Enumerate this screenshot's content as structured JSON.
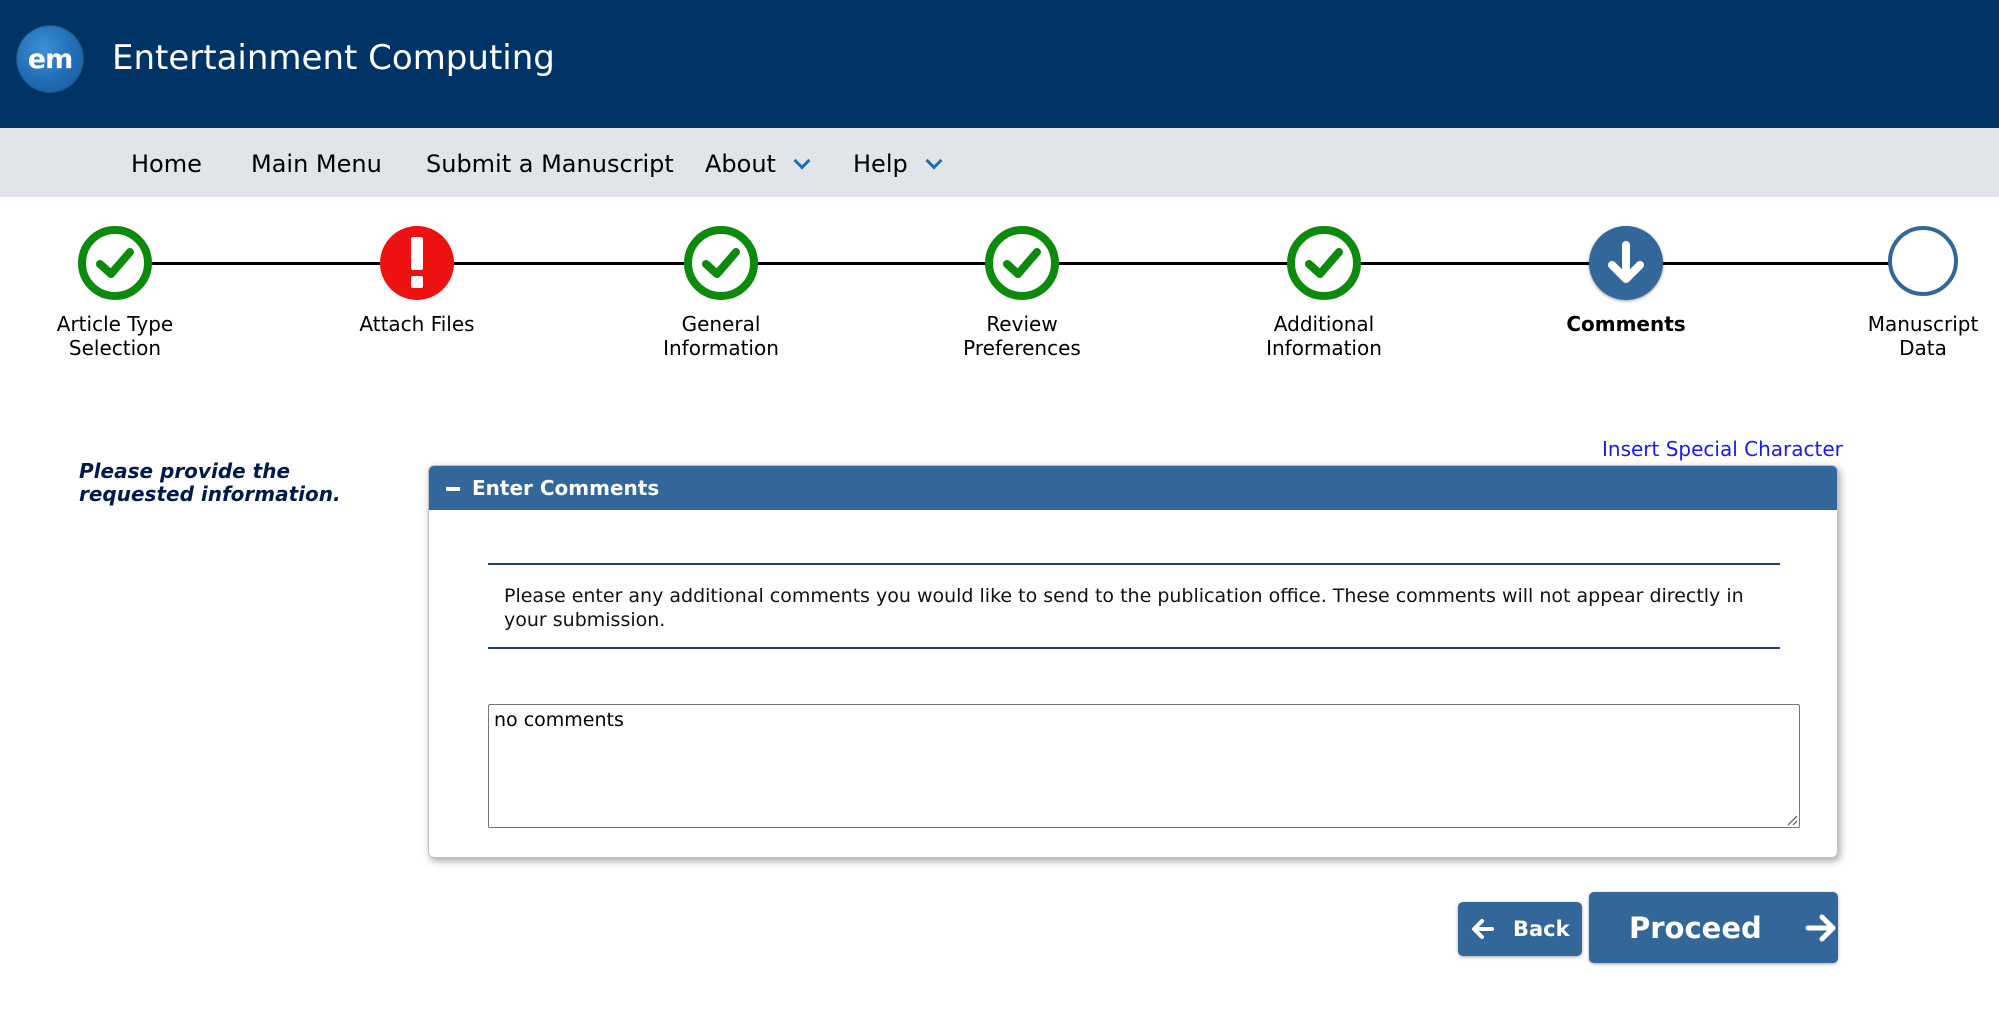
{
  "header": {
    "logo_text": "em",
    "title": "Entertainment Computing",
    "bg_color": "#003366"
  },
  "nav": {
    "items": [
      {
        "label": "Home"
      },
      {
        "label": "Main Menu"
      },
      {
        "label": "Submit a Manuscript"
      },
      {
        "label": "About",
        "has_dropdown": true
      },
      {
        "label": "Help",
        "has_dropdown": true
      }
    ]
  },
  "steps": [
    {
      "label_line1": "Article Type",
      "label_line2": "Selection",
      "status": "complete",
      "icon": "check-icon"
    },
    {
      "label_line1": "Attach Files",
      "label_line2": "",
      "status": "error",
      "icon": "exclamation-icon"
    },
    {
      "label_line1": "General",
      "label_line2": "Information",
      "status": "complete",
      "icon": "check-icon"
    },
    {
      "label_line1": "Review",
      "label_line2": "Preferences",
      "status": "complete",
      "icon": "check-icon"
    },
    {
      "label_line1": "Additional",
      "label_line2": "Information",
      "status": "complete",
      "icon": "check-icon"
    },
    {
      "label_line1": "Comments",
      "label_line2": "",
      "status": "current",
      "icon": "arrow-down-icon"
    },
    {
      "label_line1": "Manuscript",
      "label_line2": "Data",
      "status": "pending",
      "icon": "empty-circle-icon"
    }
  ],
  "main": {
    "side_note": "Please provide the requested information.",
    "special_char_link": "Insert Special Character",
    "panel": {
      "title": "Enter Comments",
      "instructions": "Please enter any additional comments you would like to send to the publication office. These comments will not appear directly in your submission.",
      "comment_value": "no comments"
    }
  },
  "buttons": {
    "back_label": "Back",
    "proceed_label": "Proceed"
  },
  "colors": {
    "accent": "#336699",
    "success": "#0b8a0b",
    "error": "#ee1111",
    "link": "#1a1aee"
  }
}
